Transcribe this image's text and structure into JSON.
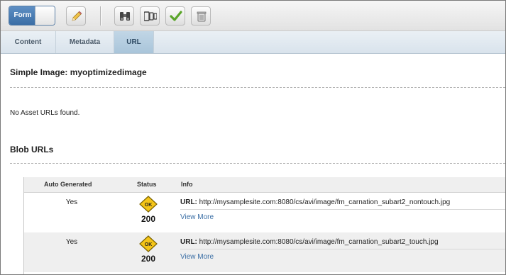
{
  "toolbar": {
    "form_toggle_label": "Form",
    "icons": [
      "pencil-icon",
      "binoculars-icon",
      "devices-icon",
      "checkmark-icon",
      "trash-icon"
    ]
  },
  "tabs": [
    {
      "label": "Content",
      "active": false
    },
    {
      "label": "Metadata",
      "active": false
    },
    {
      "label": "URL",
      "active": true
    }
  ],
  "page_title": "Simple Image: myoptimizedimage",
  "asset_urls_message": "No Asset URLs found.",
  "blob_section_title": "Blob URLs",
  "blob_table": {
    "columns": {
      "auto": "Auto Generated",
      "status": "Status",
      "info": "Info"
    },
    "rows": [
      {
        "auto": "Yes",
        "status_badge": "OK",
        "status_code": "200",
        "url_label": "URL:",
        "url": "http://mysamplesite.com:8080/cs/avi/image/fm_carnation_subart2_nontouch.jpg",
        "link": "View More"
      },
      {
        "auto": "Yes",
        "status_badge": "OK",
        "status_code": "200",
        "url_label": "URL:",
        "url": "http://mysamplesite.com:8080/cs/avi/image/fm_carnation_subart2_touch.jpg",
        "link": "View More"
      }
    ]
  },
  "colors": {
    "accent": "#3b6ea5",
    "status_ok": "#f5c518",
    "link": "#3a6ea5"
  }
}
